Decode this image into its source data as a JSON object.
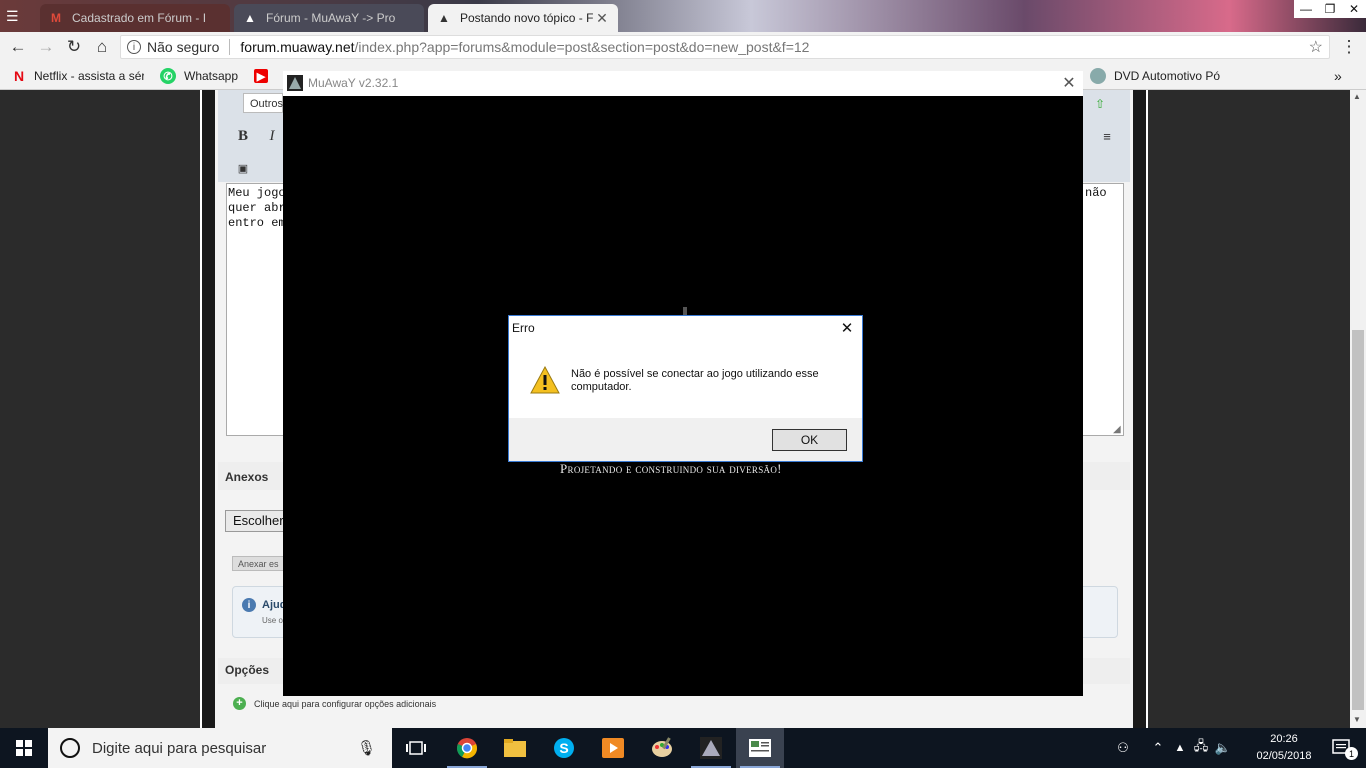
{
  "browser": {
    "tabs": [
      {
        "title": "Cadastrado em Fórum - I",
        "active": false
      },
      {
        "title": "Fórum - MuAwaY -> Pro",
        "active": false
      },
      {
        "title": "Postando novo tópico - F",
        "active": true
      }
    ],
    "address": {
      "security": "Não seguro",
      "domain": "forum.muaway.net",
      "path": "/index.php?app=forums&module=post&section=post&do=new_post&f=12"
    },
    "bookmarks": [
      {
        "label": "Netflix - assista a sér"
      },
      {
        "label": "Whatsapp"
      },
      {
        "label": "DVD Automotivo Pó"
      }
    ],
    "more": "»"
  },
  "forum": {
    "font_select": "Outros",
    "text_left": "Meu jogo\nquer abr\nentro em",
    "text_right": "não",
    "attachments_title": "Anexos",
    "choose_file": "Escolher",
    "attach_button": "Anexar es",
    "help_title": "Ajud",
    "help_sub": "Use o",
    "options_title": "Opções",
    "options_link": "Clique aqui para configurar opções adicionais"
  },
  "game": {
    "title": "MuAwaY v2.32.1",
    "tagline": "Projetando e construindo sua diversão!"
  },
  "dialog": {
    "title": "Erro",
    "message": "Não é possível se conectar ao jogo utilizando esse computador.",
    "ok": "OK"
  },
  "taskbar": {
    "search_placeholder": "Digite aqui para pesquisar",
    "time": "20:26",
    "date": "02/05/2018",
    "notifications": "1"
  },
  "colors": {
    "accent": "#3a7bd5",
    "taskbar": "#0d1520",
    "game_bg": "#000000"
  }
}
